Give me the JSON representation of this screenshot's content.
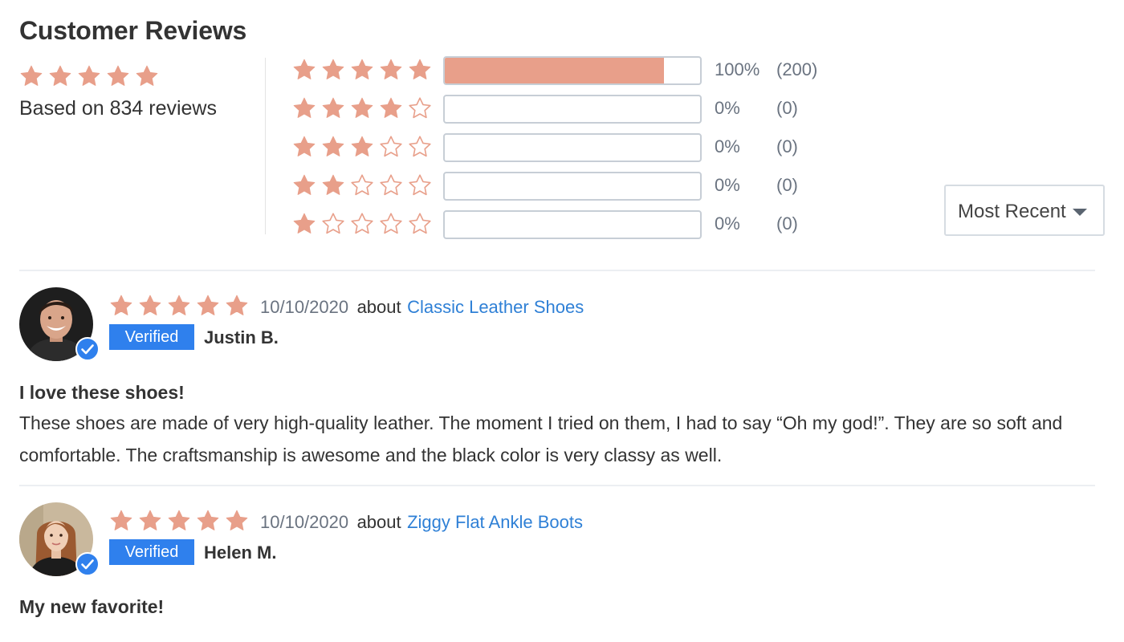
{
  "header": {
    "title": "Customer Reviews"
  },
  "colors": {
    "star_filled": "#E89F8A",
    "bar_fill": "#E89F8A",
    "link": "#2F80D6",
    "badge": "#2F80ED",
    "muted_text": "#6A7380"
  },
  "summary": {
    "rating": 5,
    "based_on_text": "Based on 834 reviews"
  },
  "distribution": [
    {
      "stars": 5,
      "fraction": 0.86,
      "percent_label": "100%",
      "count_label": "(200)"
    },
    {
      "stars": 4,
      "fraction": 0,
      "percent_label": "0%",
      "count_label": "(0)"
    },
    {
      "stars": 3,
      "fraction": 0,
      "percent_label": "0%",
      "count_label": "(0)"
    },
    {
      "stars": 2,
      "fraction": 0,
      "percent_label": "0%",
      "count_label": "(0)"
    },
    {
      "stars": 1,
      "fraction": 0,
      "percent_label": "0%",
      "count_label": "(0)"
    }
  ],
  "sort": {
    "selected": "Most Recent",
    "icon": "caret-down-icon"
  },
  "reviews": [
    {
      "rating": 5,
      "date": "10/10/2020",
      "about_label": "about",
      "product": "Classic Leather Shoes",
      "badge": "Verified",
      "reviewer": "Justin B.",
      "title": "I love these shoes!",
      "body": "These shoes are made of very high-quality leather. The moment I tried on them, I had to say “Oh my god!”. They are so soft and comfortable. The craftsmanship is awesome and the black color is very classy as well."
    },
    {
      "rating": 5,
      "date": "10/10/2020",
      "about_label": "about",
      "product": "Ziggy Flat Ankle Boots",
      "badge": "Verified",
      "reviewer": "Helen M.",
      "title": "My new favorite!",
      "body": ""
    }
  ]
}
